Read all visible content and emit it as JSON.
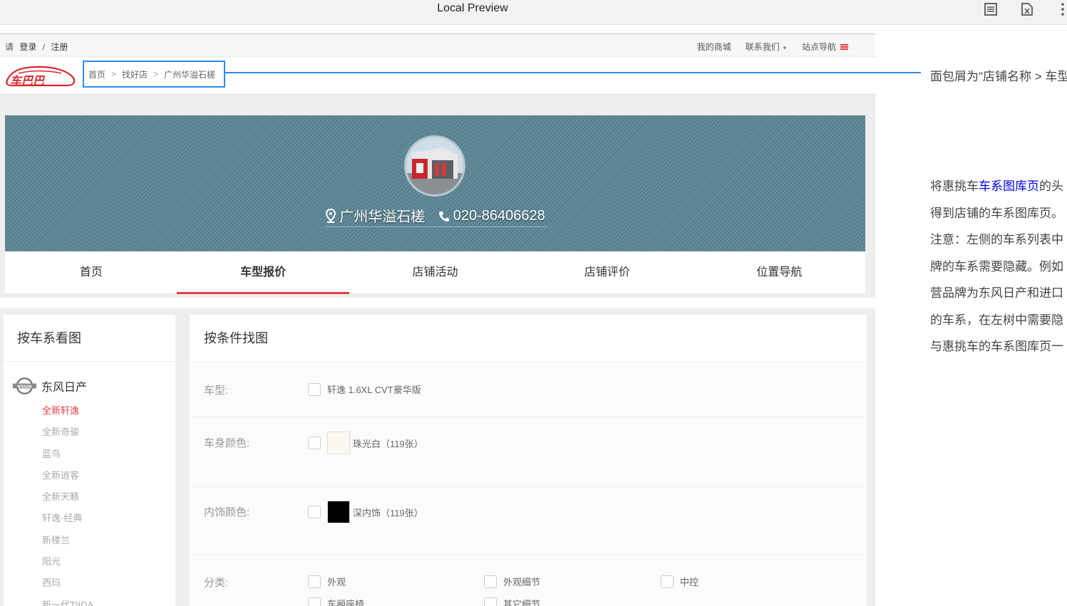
{
  "preview": {
    "title": "Local Preview"
  },
  "topbar": {
    "login_prefix": "请",
    "login": "登录",
    "divider": "/",
    "register": "注册",
    "links": [
      "我的商城",
      "联系我们",
      "站点导航"
    ]
  },
  "header": {
    "logo_text": "车巴巴",
    "breadcrumb": [
      "首页",
      "找好店",
      "广州华溢石槎"
    ],
    "breadcrumb_sep": ">"
  },
  "banner": {
    "shop_name": "广州华溢石槎",
    "phone": "020-86406628"
  },
  "tabs": [
    {
      "label": "首页",
      "active": false
    },
    {
      "label": "车型报价",
      "active": true
    },
    {
      "label": "店铺活动",
      "active": false
    },
    {
      "label": "店铺评价",
      "active": false
    },
    {
      "label": "位置导航",
      "active": false
    }
  ],
  "sidebar": {
    "title": "按车系看图",
    "brand": "东风日产",
    "series": [
      "全新轩逸",
      "全新奇骏",
      "蓝鸟",
      "全新逍客",
      "全新天籁",
      "轩逸·经典",
      "新楼兰",
      "阳光",
      "西玛",
      "新一代TIIDA"
    ],
    "active_index": 0
  },
  "main": {
    "title": "按条件找图",
    "filters": {
      "model_label": "车型:",
      "model_option": "轩逸 1.6XL CVT豪华版",
      "body_color_label": "车身颜色:",
      "body_color_option": "珠光白（119张）",
      "body_color_hex": "#fbf8f1",
      "interior_label": "内饰颜色:",
      "interior_option": "深内饰（119张）",
      "interior_hex": "#000000",
      "category_label": "分类:",
      "categories": [
        "外观",
        "外观细节",
        "中控",
        "车厢座椅",
        "其它细节"
      ]
    }
  },
  "notes": {
    "breadcrumb_note": "面包屑为\"店铺名称 > 车型",
    "gallery_note_prefix": "将惠挑车",
    "gallery_note_link": "车系图库页",
    "gallery_note_suffix": "的头",
    "lines": [
      "得到店铺的车系图库页。",
      "注意：左侧的车系列表中",
      "牌的车系需要隐藏。例如",
      "营品牌为东风日产和进口",
      "的车系，在左树中需要隐",
      "与惠挑车的车系图库页一"
    ]
  },
  "colors": {
    "accent": "#e04040",
    "callout": "#2a8df0",
    "banner": "#5a8594"
  }
}
